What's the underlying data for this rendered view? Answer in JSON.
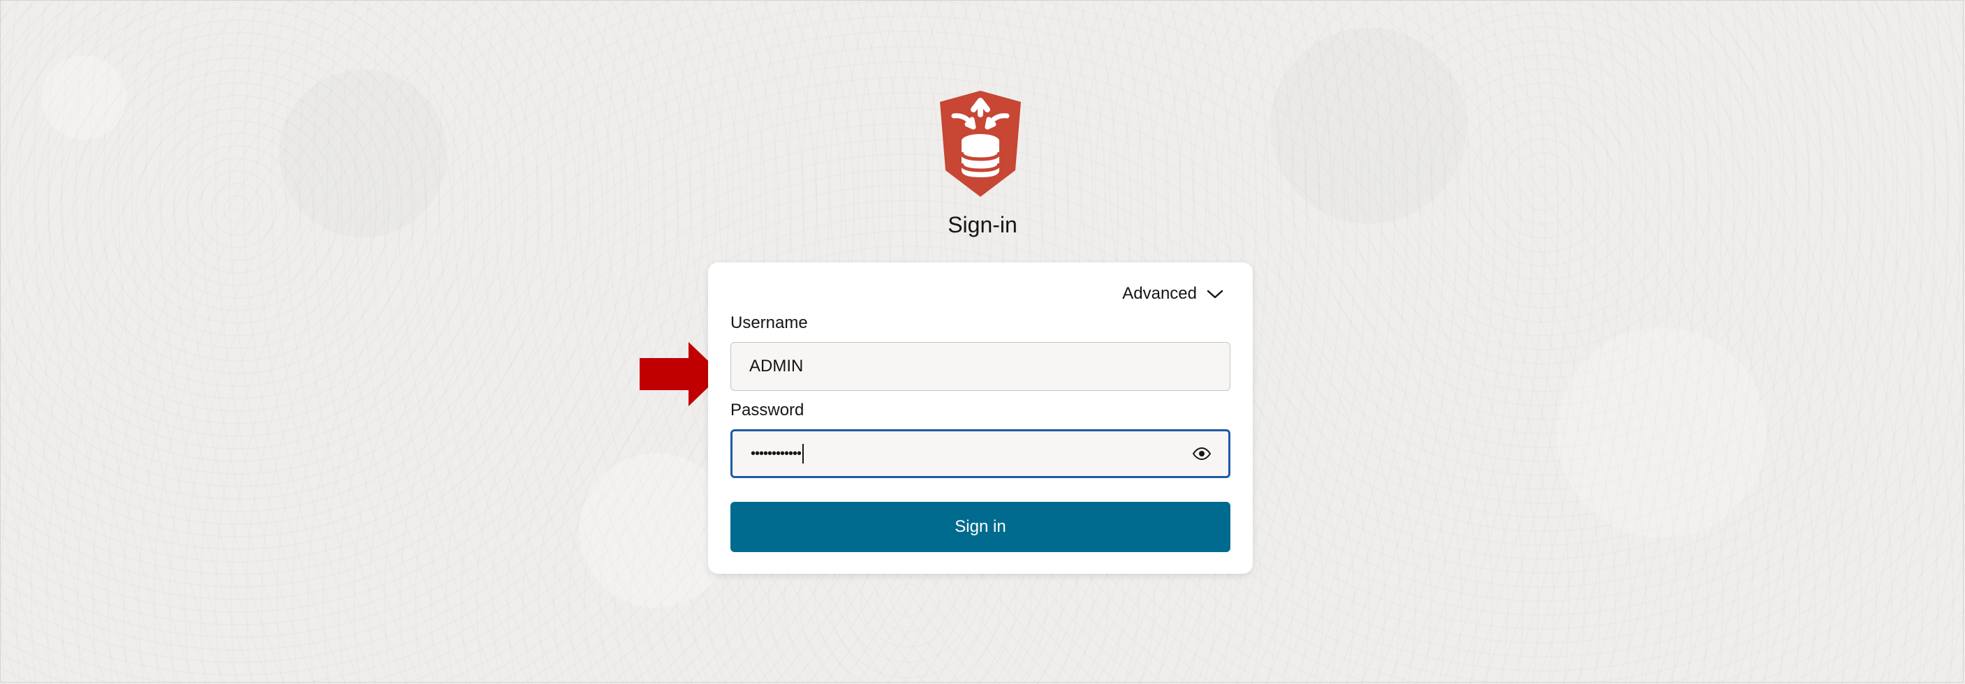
{
  "login": {
    "title": "Sign-in",
    "advanced_label": "Advanced",
    "username_label": "Username",
    "username_value": "ADMIN",
    "password_label": "Password",
    "password_mask": "••••••••••••",
    "sign_in_label": "Sign in"
  },
  "icons": {
    "logo": "database-shield-logo",
    "advanced": "chevron-down-icon",
    "password_toggle": "eye-icon",
    "pointer": "red-arrow-icon"
  },
  "colors": {
    "background": "#efeeec",
    "logo_red": "#c74634",
    "focus_border": "#1f5aa6",
    "primary_button": "#006b8f",
    "annotation_arrow": "#c00000"
  }
}
